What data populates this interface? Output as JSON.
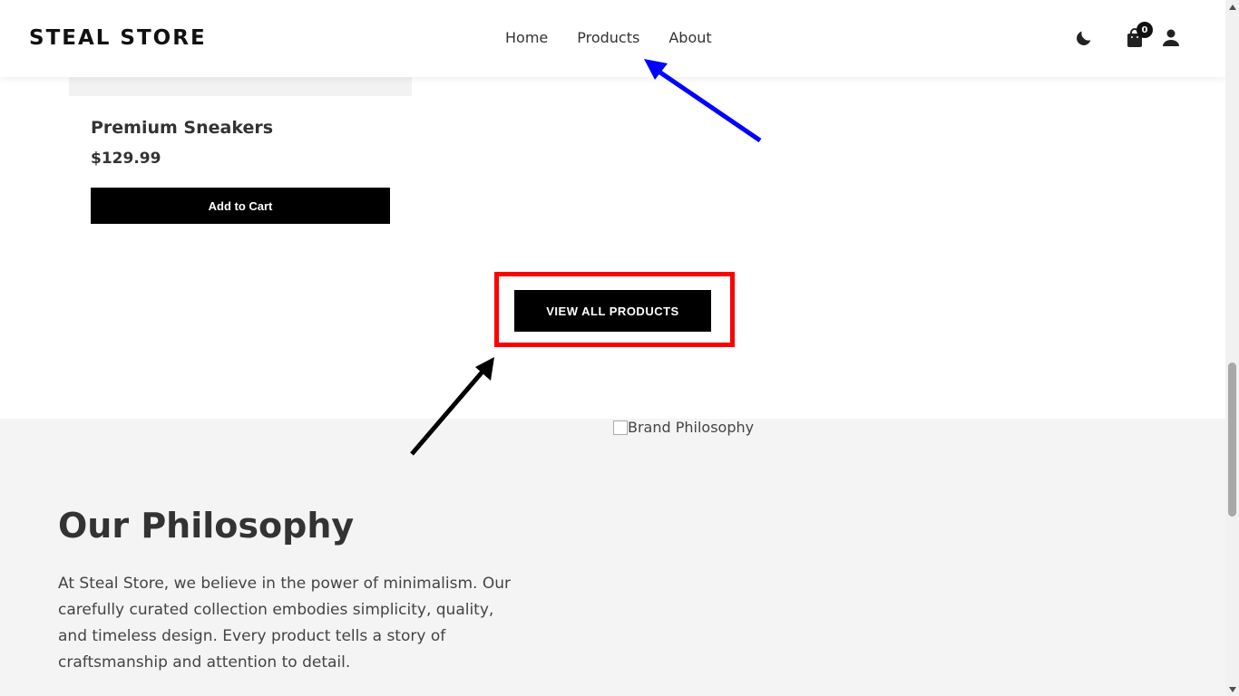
{
  "header": {
    "brand": "STEAL STORE",
    "nav": [
      "Home",
      "Products",
      "About"
    ],
    "cart_count": "0",
    "icons": [
      "moon-icon",
      "shopping-bag-icon",
      "user-icon"
    ]
  },
  "product": {
    "name": "Premium Sneakers",
    "price": "$129.99",
    "add_to_cart_label": "Add to Cart"
  },
  "view_all_label": "VIEW ALL PRODUCTS",
  "philosophy": {
    "image_alt": "Brand Philosophy",
    "title": "Our Philosophy",
    "text": "At Steal Store, we believe in the power of minimalism. Our carefully curated collection embodies simplicity, quality, and timeless design. Every product tells a story of craftsmanship and attention to detail."
  },
  "annotations": {
    "highlight_color": "#ff0000",
    "arrow_colors": [
      "#0000ff",
      "#000000"
    ]
  }
}
